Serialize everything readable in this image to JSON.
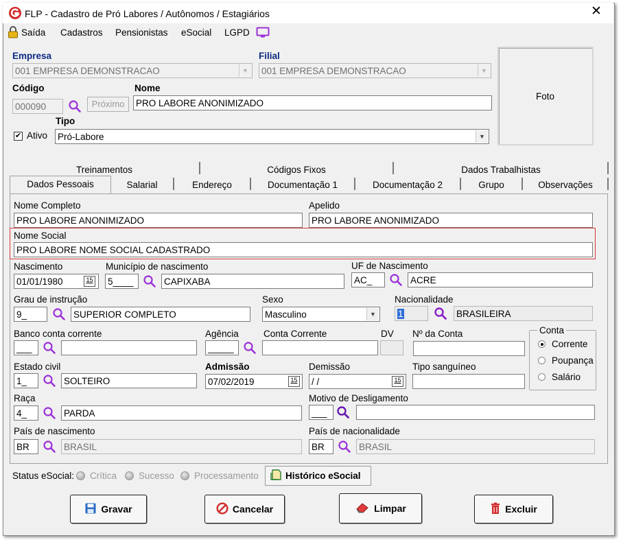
{
  "window": {
    "title": "FLP - Cadastro de Pró Labores / Autônomos / Estagiários",
    "close": "✕"
  },
  "menu": {
    "exit": "Saída",
    "registrations": "Cadastros",
    "pensioners": "Pensionistas",
    "esocial": "eSocial",
    "lgpd": "LGPD"
  },
  "header": {
    "empresa_label": "Empresa",
    "empresa_value": "001 EMPRESA DEMONSTRACAO",
    "filial_label": "Filial",
    "filial_value": "001 EMPRESA DEMONSTRACAO",
    "codigo_label": "Código",
    "codigo_value": "000090",
    "proximo_label": "Próximo",
    "nome_label": "Nome",
    "nome_value": "PRO LABORE ANONIMIZADO",
    "ativo_label": "Ativo",
    "ativo_checked": true,
    "tipo_label": "Tipo",
    "tipo_value": "Pró-Labore",
    "foto_label": "Foto"
  },
  "tabs": {
    "row1": [
      "Treinamentos",
      "Códigos Fixos",
      "Dados Trabalhistas"
    ],
    "row2": [
      "Dados Pessoais",
      "Salarial",
      "Endereço",
      "Documentação 1",
      "Documentação 2",
      "Grupo",
      "Observações"
    ],
    "active": "Dados Pessoais"
  },
  "form": {
    "nome_completo_label": "Nome Completo",
    "nome_completo_value": "PRO LABORE ANONIMIZADO",
    "apelido_label": "Apelido",
    "apelido_value": "PRO LABORE ANONIMIZADO",
    "nome_social_label": "Nome Social",
    "nome_social_value": "PRO LABORE NOME SOCIAL CADASTRADO",
    "nascimento_label": "Nascimento",
    "nascimento_value": "01/01/1980",
    "municipio_label": "Município de nascimento",
    "municipio_code": "5____",
    "municipio_value": "CAPIXABA",
    "uf_label": "UF de Nascimento",
    "uf_code": "AC_",
    "uf_value": "ACRE",
    "grau_label": "Grau de instrução",
    "grau_code": "9_",
    "grau_value": "SUPERIOR COMPLETO",
    "sexo_label": "Sexo",
    "sexo_value": "Masculino",
    "nacionalidade_label": "Nacionalidade",
    "nacionalidade_code": "1",
    "nacionalidade_value": "BRASILEIRA",
    "banco_label": "Banco conta corrente",
    "banco_code": "___",
    "banco_value": "",
    "agencia_label": "Agência",
    "agencia_value": "_____",
    "conta_corrente_label": "Conta Corrente",
    "conta_corrente_value": "",
    "dv_label": "DV",
    "dv_value": "",
    "num_conta_label": "Nº da Conta",
    "num_conta_value": "",
    "conta_group_label": "Conta",
    "conta_options": [
      "Corrente",
      "Poupança",
      "Salário"
    ],
    "conta_selected": "Corrente",
    "estado_civil_label": "Estado civil",
    "estado_civil_code": "1_",
    "estado_civil_value": "SOLTEIRO",
    "admissao_label": "Admissão",
    "admissao_value": "07/02/2019",
    "demissao_label": "Demissão",
    "demissao_value": " / /",
    "tipo_sanguineo_label": "Tipo sanguíneo",
    "tipo_sanguineo_value": "",
    "raca_label": "Raça",
    "raca_code": "4_",
    "raca_value": "PARDA",
    "motivo_label": "Motivo de Desligamento",
    "motivo_code": "___",
    "motivo_value": "",
    "pais_nasc_label": "País de nascimento",
    "pais_nasc_code": "BR",
    "pais_nasc_value": "BRASIL",
    "pais_nac_label": "País de nacionalidade",
    "pais_nac_code": "BR",
    "pais_nac_value": "BRASIL",
    "calendar_glyph": "15"
  },
  "status": {
    "label": "Status eSocial:",
    "items": [
      "Crítica",
      "Sucesso",
      "Processamento"
    ],
    "historico": "Histórico eSocial"
  },
  "actions": {
    "gravar": "Gravar",
    "cancelar": "Cancelar",
    "limpar": "Limpar",
    "excluir": "Excluir"
  },
  "colors": {
    "accent_purple": "#9b30d9",
    "title_blue": "#0d2a84",
    "highlight_red": "#d9393e",
    "logo_red": "#d22b2b"
  }
}
